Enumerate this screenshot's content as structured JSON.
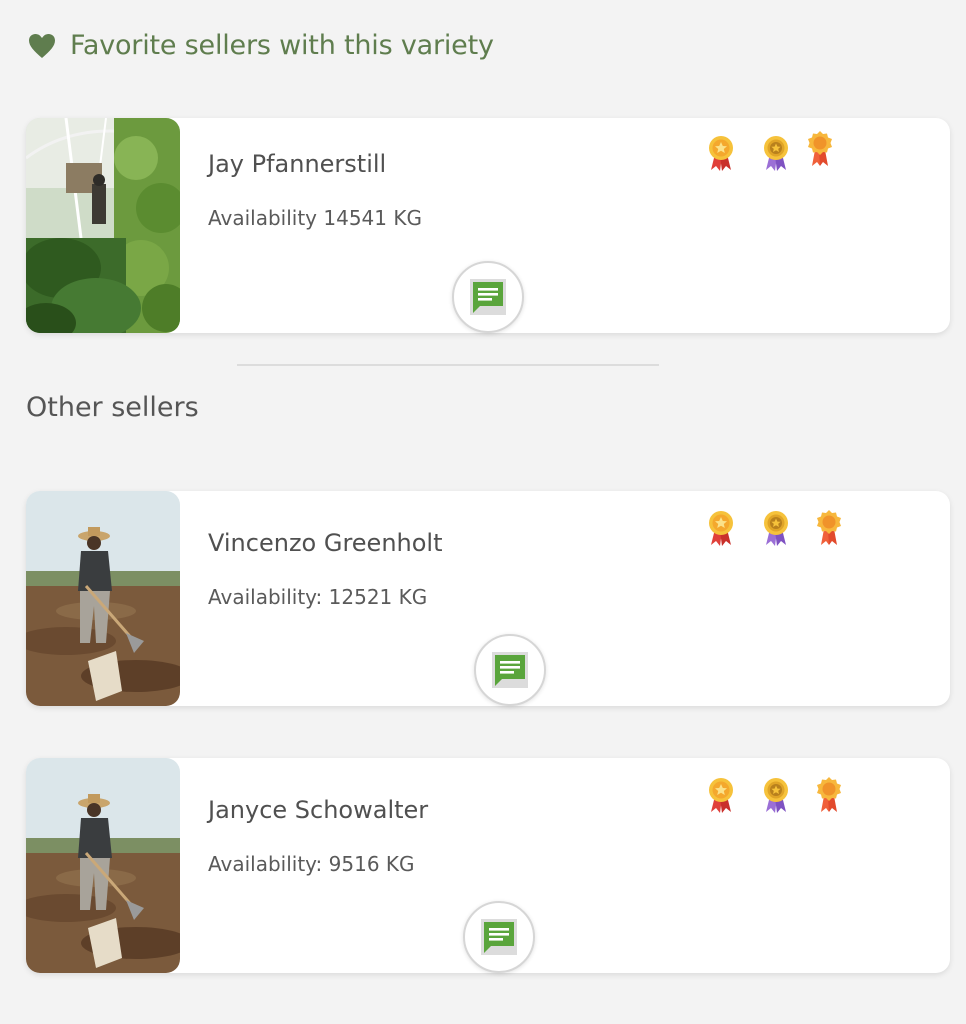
{
  "favorites": {
    "title": "Favorite sellers with this variety",
    "icon": "heart-icon",
    "accent_color": "#5f7d4e",
    "sellers": [
      {
        "name": "Jay Pfannerstill",
        "availability": "Availability 14541 KG",
        "photo": "greenhouse-photo",
        "medals": [
          "medal-red-icon",
          "medal-purple-icon",
          "medal-orange-icon"
        ]
      }
    ]
  },
  "other": {
    "title": "Other sellers",
    "sellers": [
      {
        "name": "Vincenzo Greenholt",
        "availability": "Availability: 12521 KG",
        "photo": "farmer-field-photo",
        "medals": [
          "medal-red-icon",
          "medal-purple-icon",
          "medal-orange-icon"
        ]
      },
      {
        "name": "Janyce Schowalter",
        "availability": "Availability: 9516 KG",
        "photo": "farmer-field-photo",
        "medals": [
          "medal-red-icon",
          "medal-purple-icon",
          "medal-orange-icon"
        ]
      }
    ]
  },
  "chat_button_icon": "chat-message-icon",
  "chat_icon_color": "#5aa53c"
}
